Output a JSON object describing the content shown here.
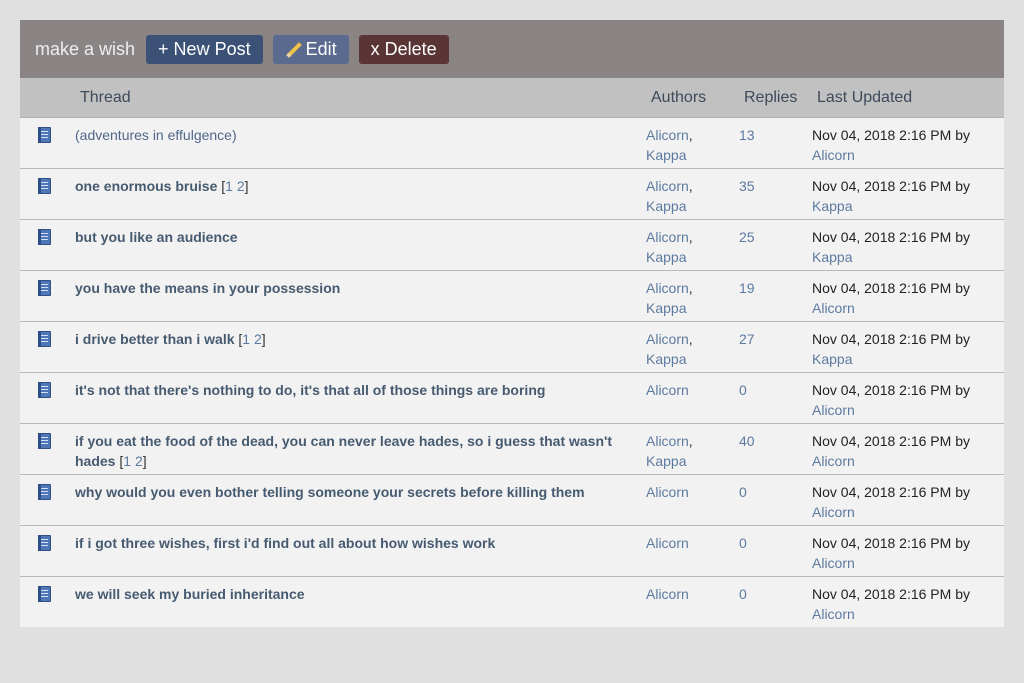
{
  "board": {
    "title": "make a wish",
    "buttons": {
      "new_post": "+ New Post",
      "edit": "Edit",
      "delete": "x Delete"
    }
  },
  "columns": {
    "thread": "Thread",
    "authors": "Authors",
    "replies": "Replies",
    "last_updated": "Last Updated"
  },
  "threads": [
    {
      "title": "(adventures in effulgence)",
      "bold": false,
      "pages": [],
      "authors": [
        "Alicorn",
        "Kappa"
      ],
      "replies": "13",
      "updated": "Nov 04, 2018 2:16 PM by",
      "updated_by": "Alicorn"
    },
    {
      "title": "one enormous bruise",
      "bold": true,
      "pages": [
        "1",
        "2"
      ],
      "authors": [
        "Alicorn",
        "Kappa"
      ],
      "replies": "35",
      "updated": "Nov 04, 2018 2:16 PM by",
      "updated_by": "Kappa"
    },
    {
      "title": "but you like an audience",
      "bold": true,
      "pages": [],
      "authors": [
        "Alicorn",
        "Kappa"
      ],
      "replies": "25",
      "updated": "Nov 04, 2018 2:16 PM by",
      "updated_by": "Kappa"
    },
    {
      "title": "you have the means in your possession",
      "bold": true,
      "pages": [],
      "authors": [
        "Alicorn",
        "Kappa"
      ],
      "replies": "19",
      "updated": "Nov 04, 2018 2:16 PM by",
      "updated_by": "Alicorn"
    },
    {
      "title": "i drive better than i walk",
      "bold": true,
      "pages": [
        "1",
        "2"
      ],
      "authors": [
        "Alicorn",
        "Kappa"
      ],
      "replies": "27",
      "updated": "Nov 04, 2018 2:16 PM by",
      "updated_by": "Kappa"
    },
    {
      "title": "it's not that there's nothing to do, it's that all of those things are boring",
      "bold": true,
      "pages": [],
      "authors": [
        "Alicorn"
      ],
      "replies": "0",
      "updated": "Nov 04, 2018 2:16 PM by",
      "updated_by": "Alicorn"
    },
    {
      "title": "if you eat the food of the dead, you can never leave hades, so i guess that wasn't hades",
      "bold": true,
      "pages": [
        "1",
        "2"
      ],
      "authors": [
        "Alicorn",
        "Kappa"
      ],
      "replies": "40",
      "updated": "Nov 04, 2018 2:16 PM by",
      "updated_by": "Alicorn"
    },
    {
      "title": "why would you even bother telling someone your secrets before killing them",
      "bold": true,
      "pages": [],
      "authors": [
        "Alicorn"
      ],
      "replies": "0",
      "updated": "Nov 04, 2018 2:16 PM by",
      "updated_by": "Alicorn"
    },
    {
      "title": "if i got three wishes, first i'd find out all about how wishes work",
      "bold": true,
      "pages": [],
      "authors": [
        "Alicorn"
      ],
      "replies": "0",
      "updated": "Nov 04, 2018 2:16 PM by",
      "updated_by": "Alicorn"
    },
    {
      "title": "we will seek my buried inheritance",
      "bold": true,
      "pages": [],
      "authors": [
        "Alicorn"
      ],
      "replies": "0",
      "updated": "Nov 04, 2018 2:16 PM by",
      "updated_by": "Alicorn"
    }
  ]
}
